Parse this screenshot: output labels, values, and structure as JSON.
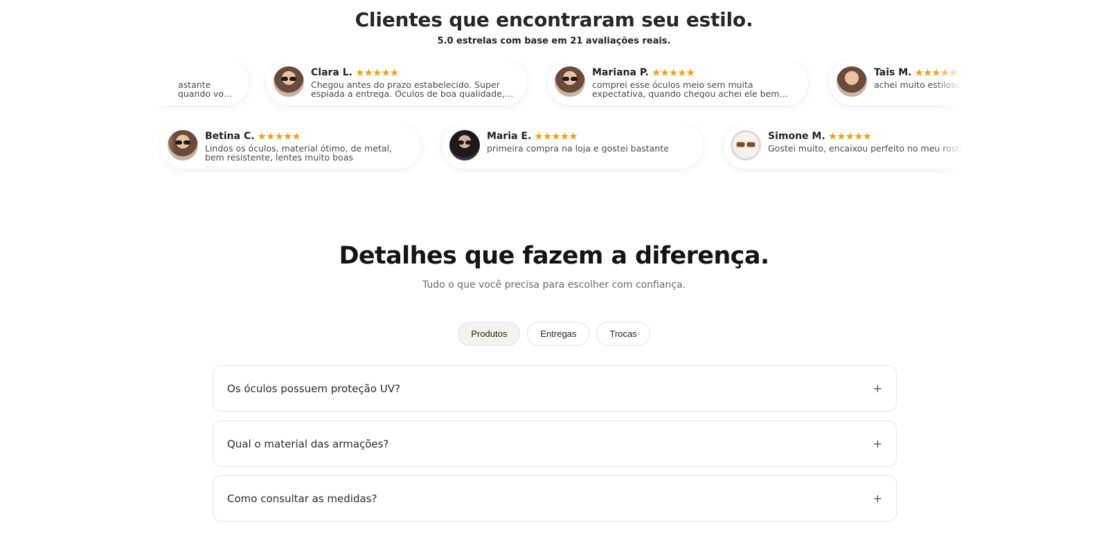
{
  "reviews": {
    "title": "Clientes que encontraram seu estilo.",
    "subtitle": "5.0 estrelas com base em 21 avaliações reais.",
    "stars": "★★★★★",
    "row1": [
      {
        "name": "",
        "text": "astante quando vou sair"
      },
      {
        "name": "Clara L.",
        "text": "Chegou antes do prazo estabelecido. Super espiada a entrega. Óculos de boa qualidade, não é de..."
      },
      {
        "name": "Mariana P.",
        "text": "comprei esse óculos meio sem muita expectativa, quando chegou achei ele bem bonito mesmo, a..."
      },
      {
        "name": "Tais M.",
        "text": "achei muito estiloso"
      }
    ],
    "row2": [
      {
        "name": "Betina C.",
        "text": "Lindos os óculos, material ótimo, de metal, bem resistente, lentes muito boas"
      },
      {
        "name": "Maria E.",
        "text": "primeira compra na loja e gostei bastante"
      },
      {
        "name": "Simone M.",
        "text": "Gostei muito, encaixou perfeito no meu rosto!"
      }
    ]
  },
  "details": {
    "title": "Detalhes que fazem a diferença.",
    "subtitle": "Tudo o que você precisa para escolher com confiança.",
    "tabs": [
      {
        "label": "Produtos",
        "active": true
      },
      {
        "label": "Entregas",
        "active": false
      },
      {
        "label": "Trocas",
        "active": false
      }
    ],
    "faqs": [
      {
        "question": "Os óculos possuem proteção UV?",
        "icon": "+"
      },
      {
        "question": "Qual o material das armações?",
        "icon": "+"
      },
      {
        "question": "Como consultar as medidas?",
        "icon": "+"
      }
    ]
  },
  "colors": {
    "star": "#f59e0b",
    "active_tab_bg": "#f5f2ec"
  }
}
